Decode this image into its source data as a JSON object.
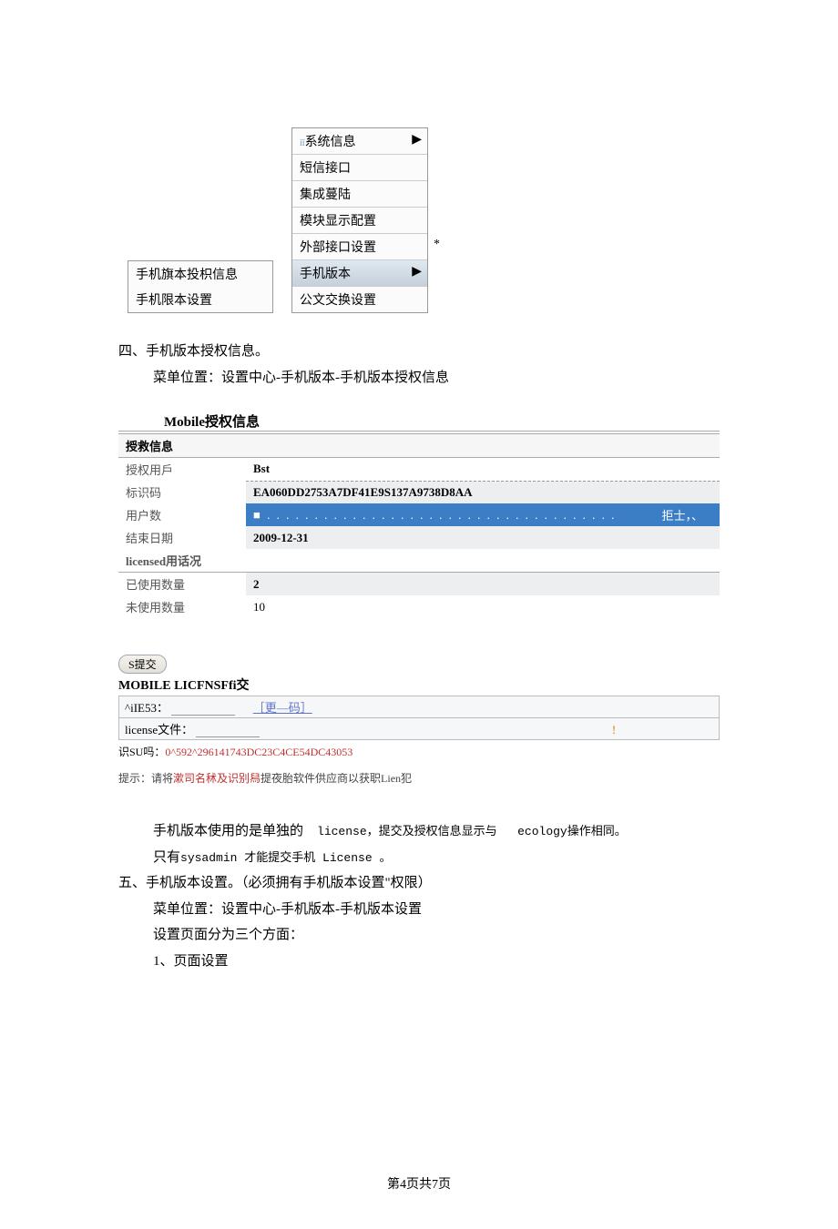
{
  "submenu": {
    "item1": "手机旗本投枳信息",
    "item2": "手机限本设置"
  },
  "mainmenu": {
    "sysinfo": "系统信息",
    "sms": "短信接口",
    "integ": "集成蔓陆",
    "module": "模块显示配置",
    "ext": "外部接口设置",
    "mobile": "手机版本",
    "docex": "公文交换设置"
  },
  "section4": {
    "title": "四、手机版本授权信息。",
    "path": "菜单位置：设置中心-手机版本-手机版本授权信息"
  },
  "authTable": {
    "title": "Mobile授权信息",
    "hdr": "授救信息",
    "r1label": "授权用戶",
    "r1val": "Bst",
    "r2label": "标识码",
    "r2val": "EA060DD2753A7DF41E9S137A9738D8AA",
    "r3label": "用户数",
    "r3dots": "■ . . . . . . . . . . . . . . . . . . . . . . . . . . . . . . . . . . . . .",
    "r3reject": "拒士，、",
    "r4label": "结束日期",
    "r4val": "2009-12-31",
    "r5label": "licensed用话况",
    "r6label": "已使用数量",
    "r6val": "2",
    "r7label": "未使用数量",
    "r7val": "10"
  },
  "submitBtn": "S提交",
  "licenseBox": {
    "title": "MOBILE LICFNSFfi交",
    "row1label": "^iIE53：",
    "row1link": "［更—码］",
    "row2label": "license文件：",
    "row2warn": "!"
  },
  "ident": {
    "prefix": "识SU吗：",
    "code": "0^592^296141743DC23C4CE54DC43053"
  },
  "hint": {
    "prefix": "提示：请将",
    "red": "漱司名秫及识别舄",
    "suffix": "提夜胎软件供应商以获职Lien犯"
  },
  "para": {
    "p1a": "手机版本使用的是单独的",
    "p1b": "license，提交及授权信息显示与",
    "p1c": "ecology操作相同。",
    "p2a": "只有",
    "p2b": "sysadmin 才能提交手机 License 。",
    "p3": "五、手机版本设置。（必须拥有手机版本设置\"权限）",
    "p4": "菜单位置：设置中心-手机版本-手机版本设置",
    "p5": "设置页面分为三个方面：",
    "p6": "1、页面设置"
  },
  "footer": "第4页共7页"
}
